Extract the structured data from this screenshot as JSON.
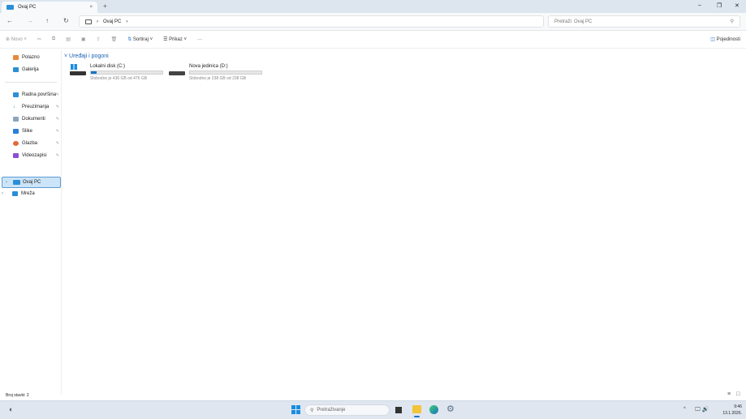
{
  "window": {
    "tab_title": "Ovaj PC",
    "new_tab": "+",
    "close_tab": "×",
    "minimize": "–",
    "maximize": "❐",
    "close": "✕"
  },
  "address": {
    "breadcrumb": "Ovaj PC",
    "search_placeholder": "Pretraži: Ovaj PC"
  },
  "toolbar": {
    "new": "Novo",
    "sort": "Sortiraj",
    "view": "Prikaz",
    "more": "···",
    "details": "Pojedinosti"
  },
  "sidebar": {
    "items": [
      {
        "label": "Polazno"
      },
      {
        "label": "Galerija"
      },
      {
        "label": "Radna površina"
      },
      {
        "label": "Preuzimanja"
      },
      {
        "label": "Dokumenti"
      },
      {
        "label": "Slike"
      },
      {
        "label": "Glazba"
      },
      {
        "label": "Videozapisi"
      },
      {
        "label": "Ovaj PC"
      },
      {
        "label": "Mreža"
      }
    ]
  },
  "main": {
    "section": "Uređaji i pogoni",
    "drives": [
      {
        "name": "Lokalni disk (C:)",
        "free": "Slobodno je 436 GB od 476 GB",
        "used_fraction": 0.084
      },
      {
        "name": "Nova jedinica (D:)",
        "free": "Slobodno je 238 GB od 238 GB",
        "used_fraction": 0.0
      }
    ]
  },
  "status": {
    "count": "Broj stavki: 2"
  },
  "taskbar": {
    "search": "Pretraživanje",
    "time": "9:46",
    "date": "13.1.2026."
  }
}
